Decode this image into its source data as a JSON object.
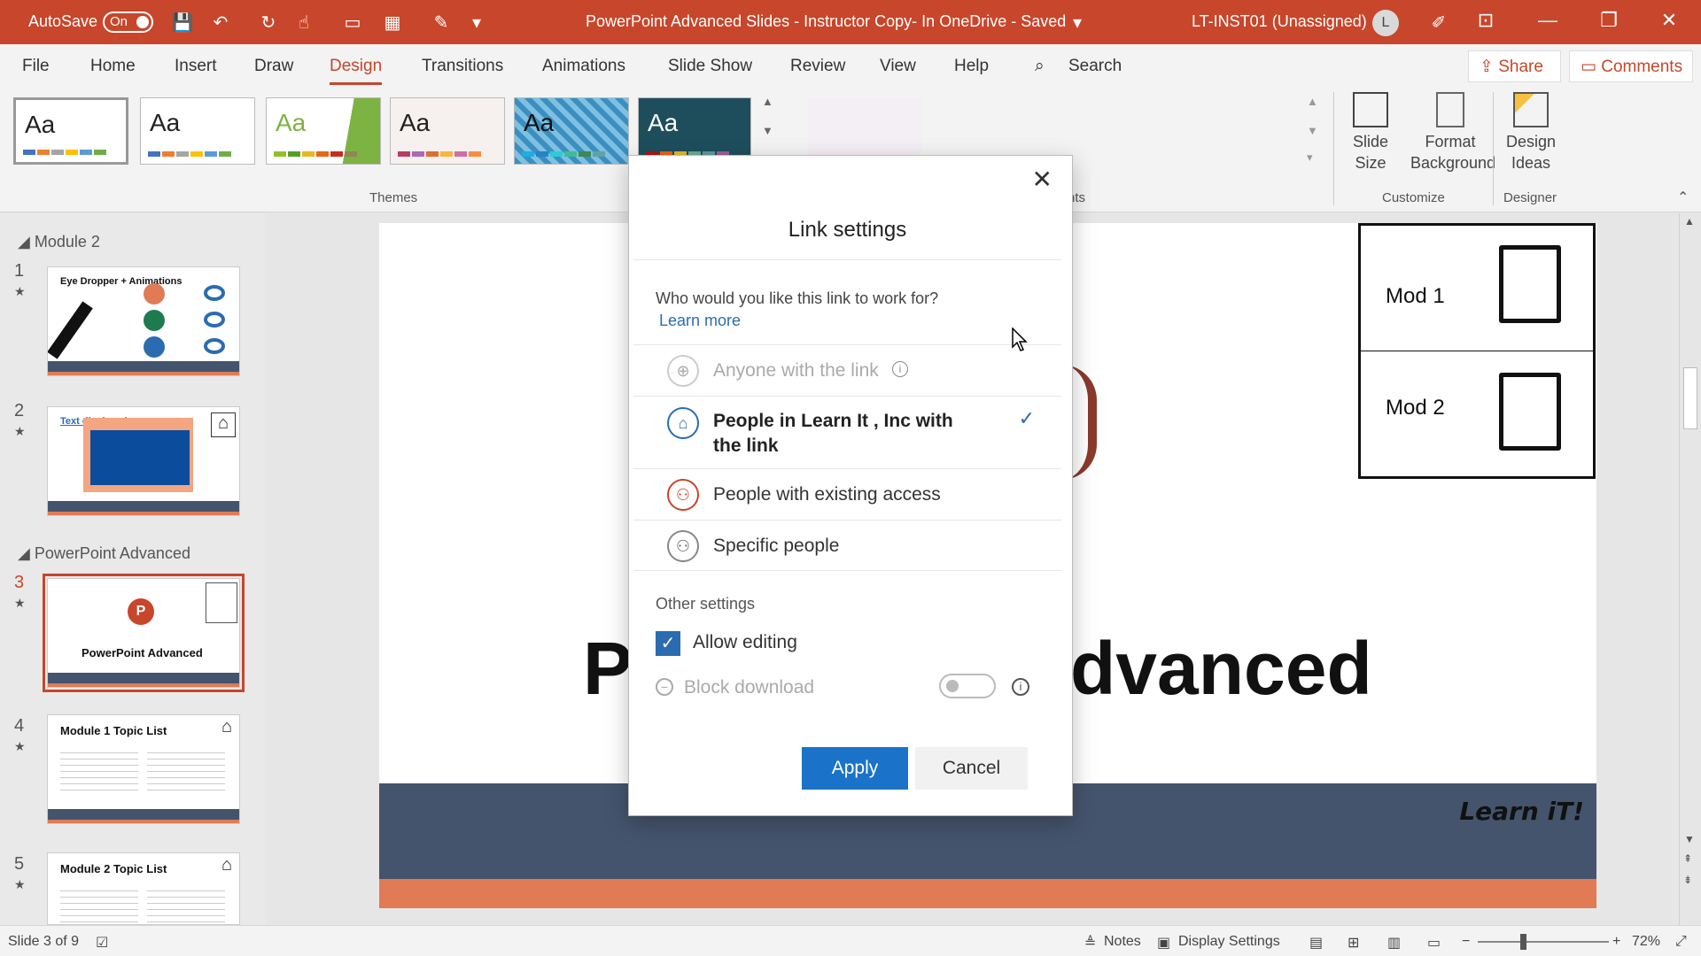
{
  "titlebar": {
    "autosave_label": "AutoSave",
    "autosave_state": "On",
    "document_title": "PowerPoint Advanced Slides - Instructor Copy- In OneDrive - Saved",
    "account": "LT-INST01 (Unassigned)",
    "avatar_initial": "L",
    "color": "#c8462b"
  },
  "ribbon": {
    "tabs": [
      "File",
      "Home",
      "Insert",
      "Draw",
      "Design",
      "Transitions",
      "Animations",
      "Slide Show",
      "Review",
      "View",
      "Help"
    ],
    "active_tab": "Design",
    "search": "Search",
    "share": "Share",
    "comments": "Comments",
    "themes_label": "Themes",
    "variants_label_fragment": "nts",
    "customize_label": "Customize",
    "designer_label": "Designer",
    "slide_size": [
      "Slide",
      "Size"
    ],
    "format_background": [
      "Format",
      "Background"
    ],
    "design_ideas": [
      "Design",
      "Ideas"
    ],
    "theme_sample": "Aa"
  },
  "thumbnails": {
    "sections": [
      "Module 2",
      "PowerPoint Advanced"
    ],
    "slides": [
      {
        "num": "1",
        "title": "Eye Dropper + Animations"
      },
      {
        "num": "2",
        "title": "Text displayed"
      },
      {
        "num": "3",
        "title": "PowerPoint Advanced"
      },
      {
        "num": "4",
        "title": "Module 1 Topic List"
      },
      {
        "num": "5",
        "title": "Module 2 Topic List"
      }
    ],
    "star": "★"
  },
  "slide": {
    "big_left": "P",
    "big_right": "dvanced",
    "brand": "Learn iT!",
    "mod1": "Mod 1",
    "mod2": "Mod 2"
  },
  "dialog": {
    "title": "Link settings",
    "question": "Who would you like this link to work for?",
    "learn_more": "Learn more",
    "options": [
      {
        "label": "Anyone with the link",
        "state": "disabled",
        "icon": "globe-icon"
      },
      {
        "label": "People in Learn It , Inc with the link",
        "state": "selected",
        "icon": "organization-icon"
      },
      {
        "label": "People with existing access",
        "state": "normal",
        "icon": "people-existing-icon"
      },
      {
        "label": "Specific people",
        "state": "normal",
        "icon": "specific-people-icon"
      }
    ],
    "other_settings": "Other settings",
    "allow_editing": "Allow editing",
    "allow_editing_checked": true,
    "block_download": "Block download",
    "block_download_on": false,
    "apply": "Apply",
    "cancel": "Cancel"
  },
  "status": {
    "slide_counter": "Slide 3 of 9",
    "notes": "Notes",
    "display_settings": "Display Settings",
    "zoom": "72%"
  }
}
